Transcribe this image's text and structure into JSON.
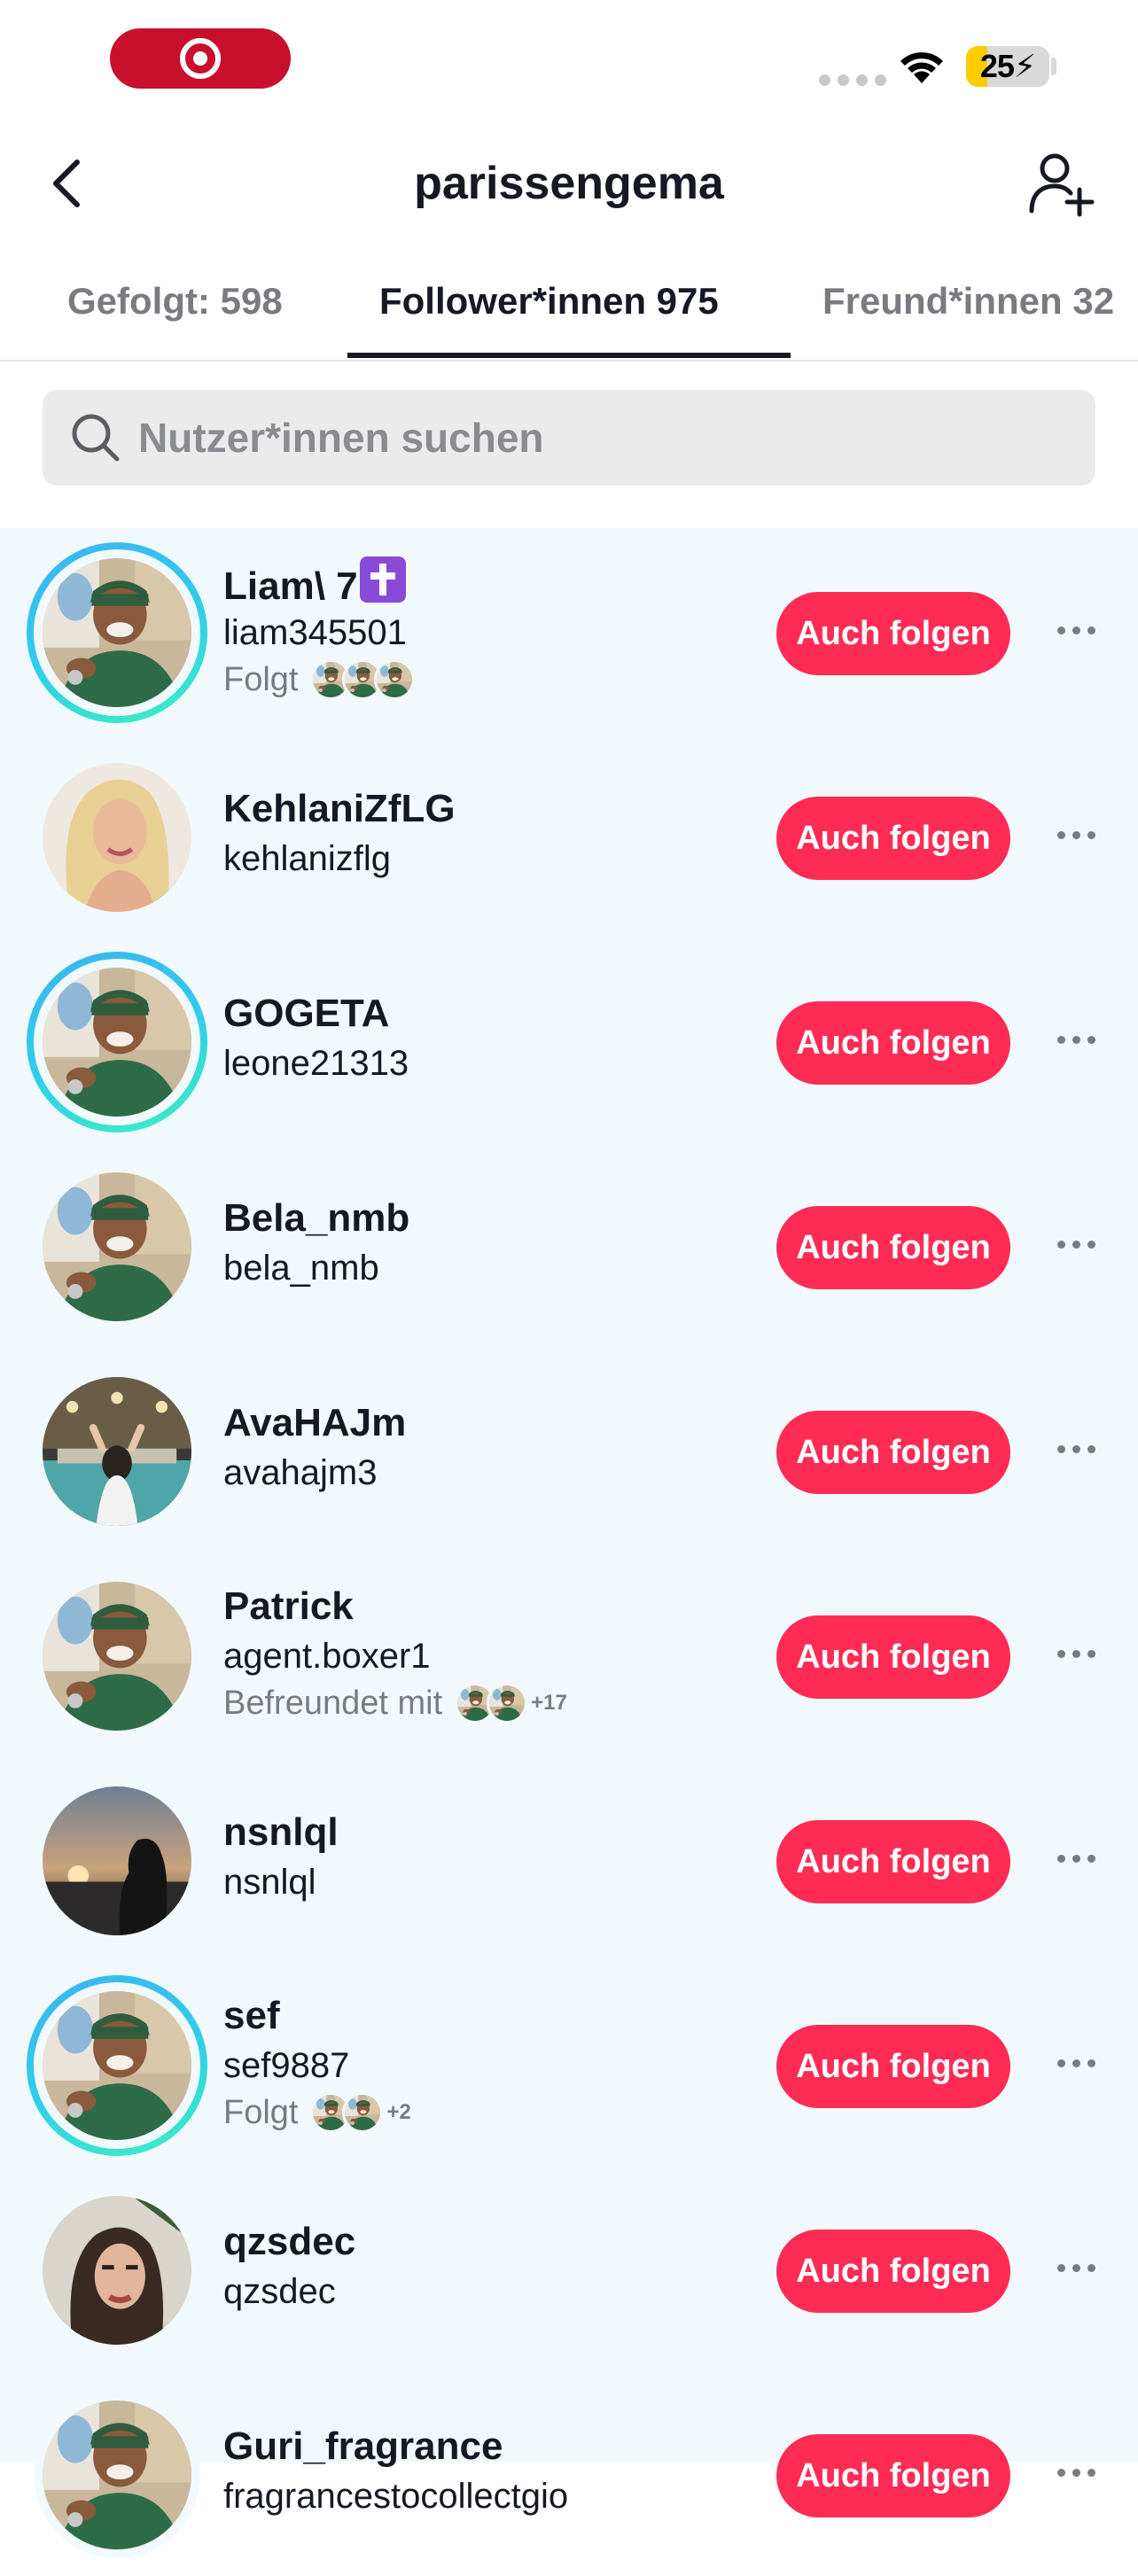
{
  "status_bar": {
    "battery_text": "25",
    "battery_level": 0.25
  },
  "header": {
    "title": "parissengema"
  },
  "tabs": [
    {
      "label": "Gefolgt: 598"
    },
    {
      "label": "Follower*innen 975"
    },
    {
      "label": "Freund*innen 32"
    }
  ],
  "search": {
    "placeholder": "Nutzer*innen suchen",
    "value": ""
  },
  "users": [
    {
      "name": "Liam\\ 7",
      "handle": "liam345501",
      "meta_label": "Folgt",
      "meta_more": "",
      "button": "Auch folgen",
      "avatar": "man-in-plane"
    },
    {
      "name": "KehlaniZfLG",
      "handle": "kehlanizflg",
      "meta_label": "",
      "meta_more": "",
      "button": "Auch folgen",
      "avatar": "blonde-woman"
    },
    {
      "name": "GOGETA",
      "handle": "leone21313",
      "meta_label": "",
      "meta_more": "",
      "button": "Auch folgen",
      "avatar": "man-in-plane"
    },
    {
      "name": "Bela_nmb",
      "handle": "bela_nmb",
      "meta_label": "",
      "meta_more": "",
      "button": "Auch folgen",
      "avatar": "man-in-plane"
    },
    {
      "name": "AvaHAJm",
      "handle": "avahajm3",
      "meta_label": "",
      "meta_more": "",
      "button": "Auch folgen",
      "avatar": "woman-pool"
    },
    {
      "name": "Patrick",
      "handle": "agent.boxer1",
      "meta_label": "Befreundet mit",
      "meta_more": "+17",
      "button": "Auch folgen",
      "avatar": "man-in-plane"
    },
    {
      "name": "nsnlql",
      "handle": "nsnlql",
      "meta_label": "",
      "meta_more": "",
      "button": "Auch folgen",
      "avatar": "sunset-silhouette"
    },
    {
      "name": "sef",
      "handle": "sef9887",
      "meta_label": "Folgt",
      "meta_more": "+2",
      "button": "Auch folgen",
      "avatar": "man-in-plane"
    },
    {
      "name": "qzsdec",
      "handle": "qzsdec",
      "meta_label": "",
      "meta_more": "",
      "button": "Auch folgen",
      "avatar": "woman-portrait"
    },
    {
      "name": "Guri_fragrance",
      "handle": "fragrancestocollectgio",
      "meta_label": "",
      "meta_more": "",
      "button": "Auch folgen",
      "avatar": "man-in-plane"
    }
  ],
  "colors": {
    "accent": "#fe2c55",
    "list_bg": "#f1f9fc",
    "story_ring": "#2fd0e8"
  }
}
